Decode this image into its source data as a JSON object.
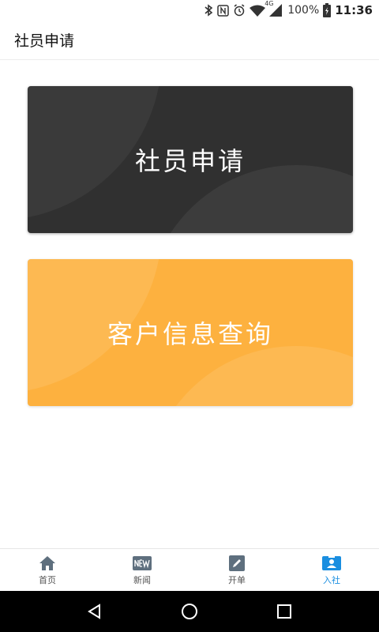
{
  "status_bar": {
    "network": "4G",
    "battery": "100%",
    "time": "11:36"
  },
  "header": {
    "title": "社员申请"
  },
  "cards": [
    {
      "label": "社员申请"
    },
    {
      "label": "客户信息查询"
    }
  ],
  "bottom_nav": {
    "items": [
      {
        "label": "首页",
        "icon": "home-icon"
      },
      {
        "label": "新闻",
        "icon": "new-badge-icon"
      },
      {
        "label": "开单",
        "icon": "pencil-icon"
      },
      {
        "label": "入社",
        "icon": "id-card-icon"
      }
    ],
    "active_index": 3
  },
  "colors": {
    "dark_card": "#303030",
    "orange_card": "#fdb13f",
    "active_nav": "#1a8ee0",
    "nav_icon": "#5e6f7e"
  }
}
